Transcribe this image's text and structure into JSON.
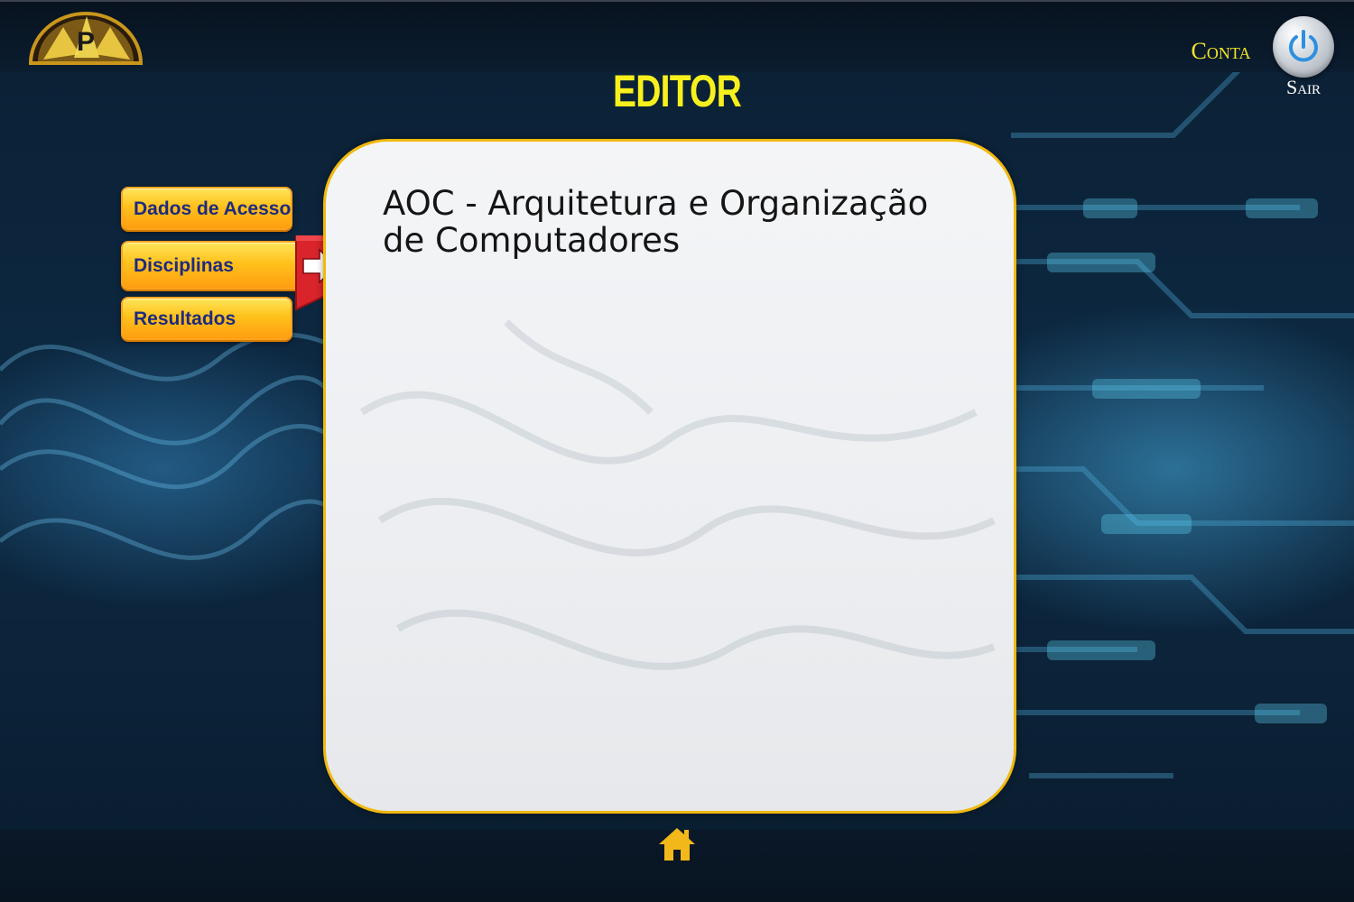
{
  "header": {
    "logo_icon": "cwb-logo",
    "page_title": "EDITOR",
    "account_label": "Conta",
    "logout_label": "Sair",
    "logout_icon": "power-icon"
  },
  "side_menu": {
    "items": [
      {
        "label": "Dados de Acesso"
      },
      {
        "label": "Disciplinas",
        "active": true
      },
      {
        "label": "Resultados"
      }
    ],
    "active_marker_icon": "arrow-right-icon"
  },
  "content": {
    "title": "AOC - Arquitetura e Organização de Computadores"
  },
  "footer": {
    "home_icon": "home-icon"
  },
  "colors": {
    "title_yellow": "#f7f01c",
    "button_orange": "#ffc21c",
    "button_text": "#1d2a80",
    "card_border": "#f0b90e",
    "bookmark_red": "#d8242a"
  }
}
